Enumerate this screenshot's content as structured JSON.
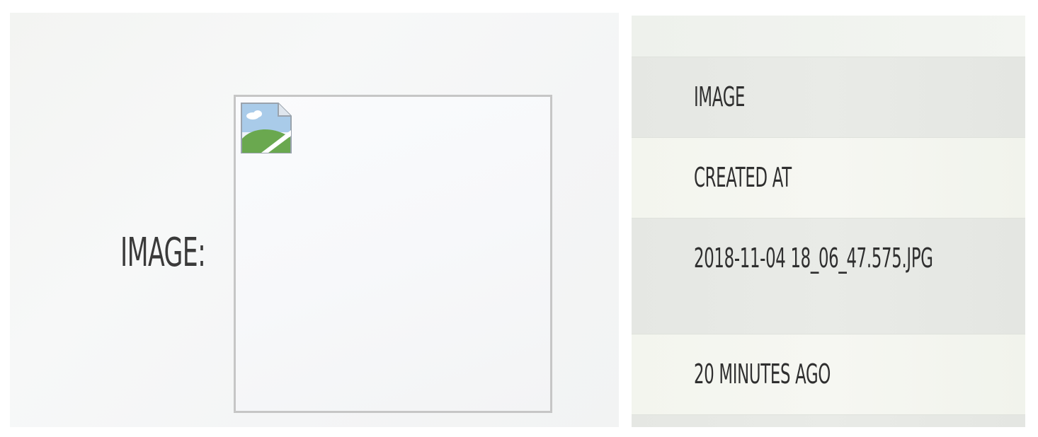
{
  "left": {
    "label": "IMAGE:",
    "image_placeholder_icon": "broken-image-icon"
  },
  "right": {
    "rows": [
      {
        "text": "IMAGE"
      },
      {
        "text": "CREATED AT"
      },
      {
        "text": "2018-11-04 18_06_47.575.JPG"
      },
      {
        "text": "20 MINUTES AGO"
      }
    ]
  },
  "colors": {
    "frame_border": "#c6c6c6",
    "text": "#2f2f2f",
    "icon_hill": "#6aa84f",
    "icon_sky": "#9fc5e8"
  }
}
